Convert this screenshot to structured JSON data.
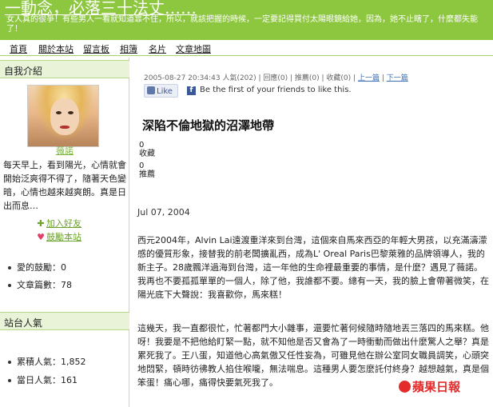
{
  "header": {
    "title": "一動念，必落三十法丈……",
    "description": "女人真的很爭！有些男人一看就知道靠不住，所以，就該把握的時候，一定要記得買付太陽眼鏡給她，因為，她不止瞎了，什麼都失能了！"
  },
  "nav": {
    "items": [
      "首頁",
      "關於本站",
      "留言板",
      "相簿",
      "名片",
      "文章地圖"
    ]
  },
  "sidebar": {
    "about_heading": "自我介紹",
    "profile_name": "薇諾",
    "bio": "每天早上，看到陽光，心情就會開始泛爽得不得了，隨著天色變暗，心情也越來越爽朗。真是日出而息…",
    "add_friend": "加入好友",
    "subscribe": "鼓勵本站",
    "stats": [
      {
        "label": "愛的鼓勵",
        "value": "0"
      },
      {
        "label": "文章篇數",
        "value": "78"
      }
    ],
    "popularity_heading": "站台人氣",
    "popularity": [
      {
        "label": "累積人氣",
        "value": "1,852"
      },
      {
        "label": "當日人氣",
        "value": "161"
      }
    ]
  },
  "post": {
    "meta": "2005-08-27 20:34:43 人氣(202) | 回應(0) | 推薦(0) | 收藏(0) |",
    "prev": "上一篇",
    "next": "下一篇",
    "fb_like": "Like",
    "fb_text": "Be the first of your friends to like this.",
    "title": "深陷不倫地獄的沼澤地帶",
    "favorites_count": "0",
    "favorites_label": "收藏",
    "recommend_count": "0",
    "recommend_label": "推薦",
    "date": "Jul 07, 2004",
    "para1": "西元2004年，Alvin Lai遠渡重洋來到台灣，這個來自馬來西亞的年輕大男孩，以充滿濤濛感的優質形象，接替我的前老闆擴亂西，成為L' Oreal Paris巴黎萊雅的品牌領導人，我的新主子。28歲飄洋過海到台灣，這一年他的生命裡最重要的事情，是什麼？遇見了薇諾。我再也不要孤孤單單的一個人，除了他，我誰都不要。總有一天，我的臉上會帶著微笑，在陽光底下大聲說：我喜歡你，馬來糕！",
    "para2": "這幾天，我一直都很忙，忙著都門大小雜事，還要忙著何候隨時隨地丟三落四的馬來糕。他呀！我要是不把他給盯緊一點，就不知他是否又會為了一時衝動而做出什麼驚人之舉？真是累死我了。王八蛋，知道他心高氣傲又任性妄為，可雖見他在辦公室同女職員調笑，心頭突地悶緊，頓時彷彿教人掐住喉嚨，無法喘息。這種男人要怎麼託付終身？越想越氣，真是個笨蛋！痛心哪，痛得快要氣死我了。",
    "watermark": "蘋果日報"
  },
  "colors": {
    "header_bg": "#8dc63f",
    "sidebar_heading_bg": "#e8f3d8",
    "link_green": "#6aa22a",
    "watermark_red": "#e32b2b"
  }
}
